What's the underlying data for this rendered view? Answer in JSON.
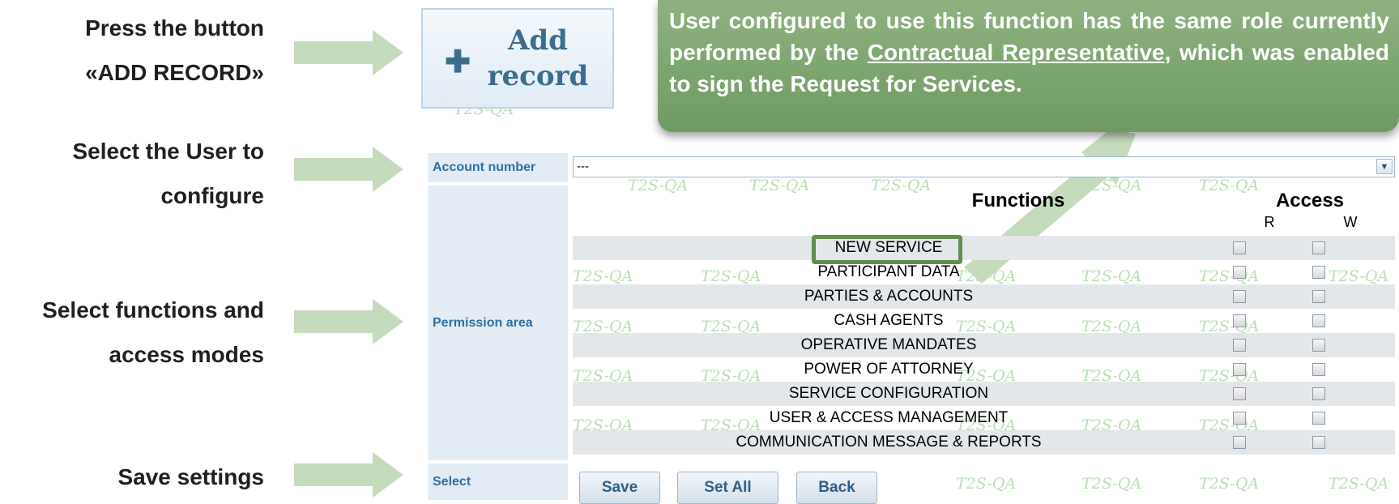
{
  "steps": [
    {
      "line1": "Press the button",
      "line2": "«ADD RECORD»"
    },
    {
      "line1": "Select the User to",
      "line2": "configure"
    },
    {
      "line1": "Select functions and",
      "line2": "access modes"
    },
    {
      "line1": "Save settings",
      "line2": ""
    }
  ],
  "add_record": {
    "icon": "plus-icon",
    "label_line1": "Add",
    "label_line2": "record"
  },
  "callout": {
    "text_before": "User configured to use this function has the same role currently performed by the ",
    "underlined": "Contractual Representative",
    "text_after": ", which was enabled to sign the Request for Services."
  },
  "form": {
    "account_label": "Account number",
    "account_value": "---",
    "permission_label": "Permission area",
    "select_label": "Select",
    "functions_header": "Functions",
    "access_header": "Access",
    "access_r": "R",
    "access_w": "W",
    "functions": [
      "NEW SERVICE",
      "PARTICIPANT DATA",
      "PARTIES & ACCOUNTS",
      "CASH AGENTS",
      "OPERATIVE MANDATES",
      "POWER OF ATTORNEY",
      "SERVICE CONFIGURATION",
      "USER & ACCESS MANAGEMENT",
      "COMMUNICATION MESSAGE & REPORTS"
    ],
    "buttons": {
      "save": "Save",
      "set_all": "Set All",
      "back": "Back"
    }
  },
  "watermark": "T2S-QA",
  "colors": {
    "arrow": "#c4dcbc",
    "callout": "#7ba46c",
    "highlight": "#5f8e4f",
    "label_bg": "#e3ecf5",
    "label_text": "#2e6da4"
  }
}
